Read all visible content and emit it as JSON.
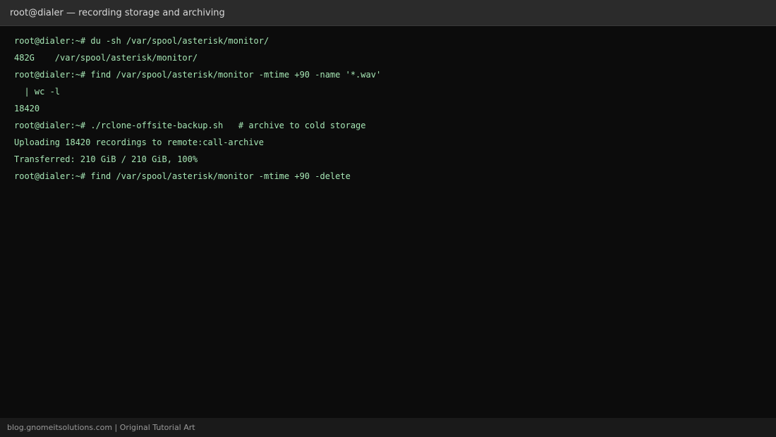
{
  "window": {
    "title": "root@dialer — recording storage and archiving"
  },
  "terminal": {
    "lines": [
      "root@dialer:~# du -sh /var/spool/asterisk/monitor/",
      "482G    /var/spool/asterisk/monitor/",
      "root@dialer:~# find /var/spool/asterisk/monitor -mtime +90 -name '*.wav'",
      "  | wc -l",
      "18420",
      "root@dialer:~# ./rclone-offsite-backup.sh   # archive to cold storage",
      "Uploading 18420 recordings to remote:call-archive",
      "Transferred: 210 GiB / 210 GiB, 100%",
      "root@dialer:~# find /var/spool/asterisk/monitor -mtime +90 -delete"
    ]
  },
  "footer": {
    "text": "blog.gnomeitsolutions.com | Original Tutorial Art"
  },
  "colors": {
    "background": "#0c0c0c",
    "titlebar": "#2b2b2b",
    "terminal_text": "#a6e6b4",
    "footer_bg": "#1a1a1a"
  }
}
